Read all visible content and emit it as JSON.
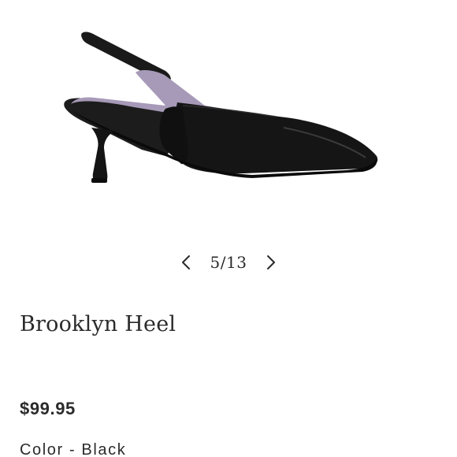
{
  "product": {
    "image_alt": "black slingback kitten heel",
    "title": "Brooklyn Heel",
    "price": "$99.95",
    "color_label": "Color",
    "color_separator": "-",
    "color_value": "Black"
  },
  "carousel": {
    "counter": "5/13",
    "prev_icon": "chevron-left-icon",
    "next_icon": "chevron-right-icon"
  },
  "colors": {
    "text": "#2b2b2b",
    "shoe": "#161616",
    "lining": "#a79ab8",
    "background": "#ffffff"
  }
}
